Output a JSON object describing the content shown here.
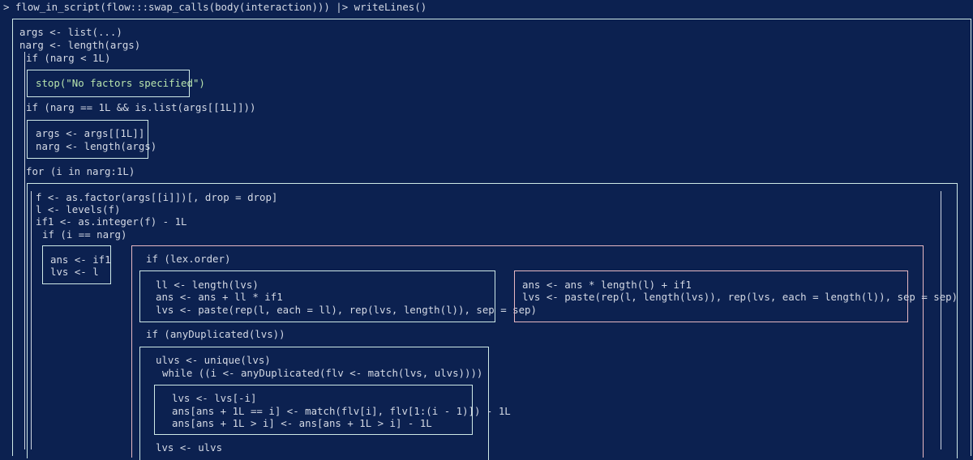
{
  "prompt_line": "> flow_in_script(flow:::swap_calls(body(interaction))) |> writeLines()",
  "lines": {
    "l1": "args <- list(...)",
    "l2": "narg <- length(args)",
    "l3": "if (narg < 1L)",
    "l4": "stop(\"No factors specified\")",
    "l5": "if (narg == 1L && is.list(args[[1L]]))",
    "l6": "args <- args[[1L]]",
    "l7": "narg <- length(args)",
    "l8": "for (i in narg:1L)",
    "l9": "f <- as.factor(args[[i]])[, drop = drop]",
    "l10": "l <- levels(f)",
    "l11": "if1 <- as.integer(f) - 1L",
    "l12": "if (i == narg)",
    "l13": "ans <- if1",
    "l14": "lvs <- l",
    "l15": "if (lex.order)",
    "l16": "ll <- length(lvs)",
    "l17": "ans <- ans + ll * if1",
    "l18": "lvs <- paste(rep(l, each = ll), rep(lvs, length(l)), sep = sep)",
    "l19": "ans <- ans * length(l) + if1",
    "l20": "lvs <- paste(rep(l, length(lvs)), rep(lvs, each = length(l)), sep = sep)",
    "l21": "if (anyDuplicated(lvs))",
    "l22": "ulvs <- unique(lvs)",
    "l23": "while ((i <- anyDuplicated(flv <- match(lvs, ulvs))))",
    "l24": "lvs <- lvs[-i]",
    "l25": "ans[ans + 1L == i] <- match(flv[i], flv[1:(i - 1)]) - 1L",
    "l26": "ans[ans + 1L > i] <- ans[ans + 1L > i] - 1L",
    "l27": "lvs <- ulvs"
  }
}
